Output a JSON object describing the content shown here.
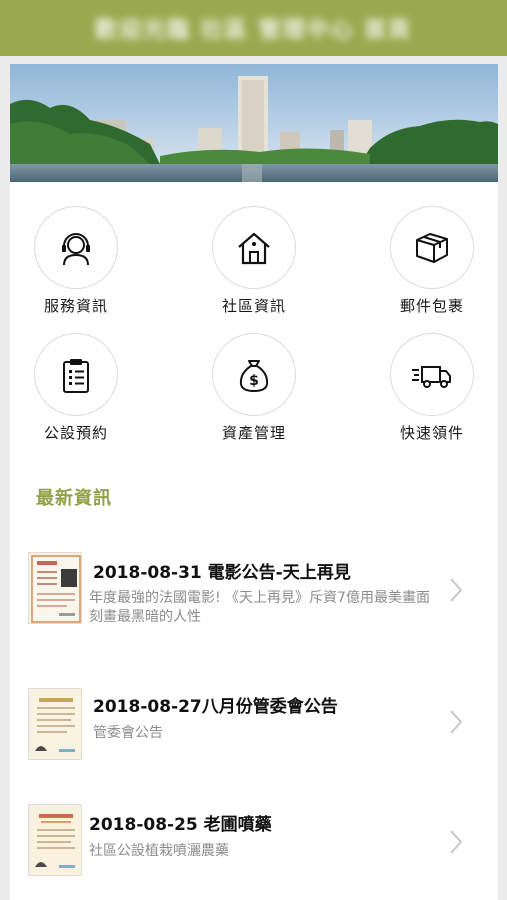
{
  "header": {
    "title": "歡迎光臨 社區 管理中心 首頁"
  },
  "menu": [
    {
      "label": "服務資訊",
      "icon": "headset-icon"
    },
    {
      "label": "社區資訊",
      "icon": "house-icon"
    },
    {
      "label": "郵件包裹",
      "icon": "package-icon"
    },
    {
      "label": "公設預約",
      "icon": "clipboard-icon"
    },
    {
      "label": "資產管理",
      "icon": "money-bag-icon"
    },
    {
      "label": "快速領件",
      "icon": "delivery-truck-icon"
    }
  ],
  "section": {
    "title": "最新資訊"
  },
  "news": [
    {
      "title": "2018-08-31 電影公告-天上再見",
      "desc": "年度最強的法國電影! 《天上再見》斥資7億用最美畫面刻畫最黑暗的人性"
    },
    {
      "title": "2018-08-27八月份管委會公告",
      "desc": "管委會公告"
    },
    {
      "title": "2018-08-25 老圃噴藥",
      "desc": "社區公設植栽噴灑農藥"
    }
  ],
  "colors": {
    "header_bg": "#9aa94f",
    "accent": "#8fa24a",
    "page_bg": "#ececec"
  }
}
